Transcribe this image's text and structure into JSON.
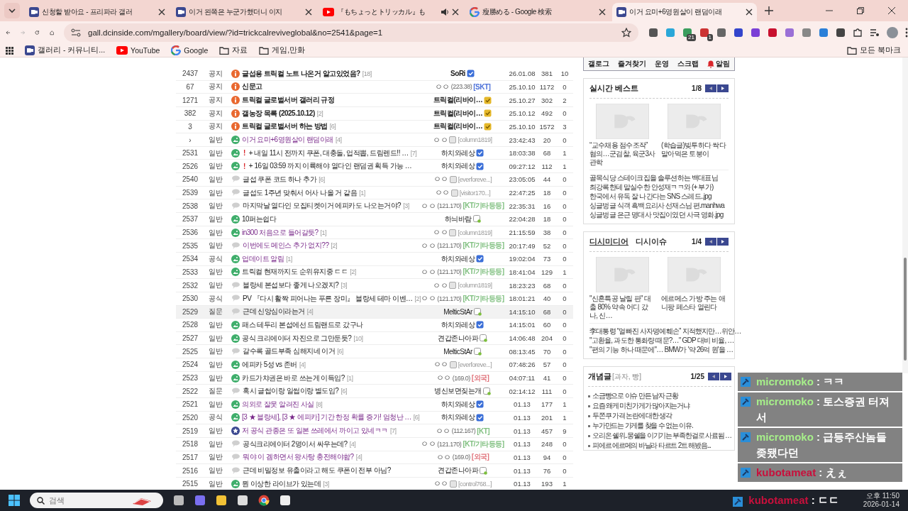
{
  "browser": {
    "tabs": [
      {
        "title": "신청할 받아요 - 프리파라 갤러",
        "kind": "dc",
        "audio": false,
        "selected": false
      },
      {
        "title": "이거 왼쪽은 누군가했더니 이지",
        "kind": "dc",
        "audio": false,
        "selected": false
      },
      {
        "title": "『もちょっとトリッカル』も",
        "kind": "youtube",
        "audio": true,
        "selected": false
      },
      {
        "title": "瘦勝める - Google 検索",
        "kind": "google",
        "audio": false,
        "selected": false
      },
      {
        "title": "이거 요미+6영원살이 랜덤이래",
        "kind": "dc",
        "audio": false,
        "selected": true
      }
    ],
    "url": "gall.dcinside.com/mgallery/board/view/?id=trickcalreviveglobal&no=2541&page=1",
    "extension_badges": [
      "21",
      "1"
    ],
    "bookmarks": [
      {
        "label": "갤러리 - 커뮤니티...",
        "kind": "dc"
      },
      {
        "label": "YouTube",
        "kind": "youtube"
      },
      {
        "label": "Google",
        "kind": "google"
      },
      {
        "label": "자료",
        "kind": "folder"
      },
      {
        "label": "게임,만화",
        "kind": "folder"
      }
    ],
    "all_bookmarks": "모든 북마크"
  },
  "posts": [
    {
      "num": "2437",
      "category": "공지",
      "kind": "notice",
      "title": "글섭용 트릭컬 노트 나온거 알고있었음?",
      "comments": "[18]",
      "visited": false,
      "hovered": false,
      "writer": {
        "kind": "nick",
        "name": "SoRi",
        "badge": {
          "kind": "fixed"
        }
      },
      "date": "26.01.08",
      "views": "381",
      "recommends": "10"
    },
    {
      "num": "67",
      "category": "공지",
      "kind": "notice",
      "title": "신문고",
      "visited": false,
      "hovered": false,
      "writer": {
        "kind": "anon",
        "name": "ㅇㅇ",
        "ip": "(223.38)",
        "carrier": "[SKT]",
        "color": "#4a6fd8"
      },
      "date": "25.10.10",
      "views": "1172",
      "recommends": "0"
    },
    {
      "num": "1271",
      "category": "공지",
      "kind": "notice",
      "title": "트릭컬 글로벌서버 갤러리 규정",
      "visited": false,
      "hovered": false,
      "writer": {
        "kind": "nick",
        "name": "트릭컬(리바이…",
        "badge": {
          "kind": "manager"
        }
      },
      "date": "25.10.27",
      "views": "302",
      "recommends": "2"
    },
    {
      "num": "382",
      "category": "공지",
      "kind": "notice",
      "title": "갤농장 목록 (2025.10.12)",
      "comments": "[2]",
      "visited": false,
      "hovered": false,
      "writer": {
        "kind": "nick",
        "name": "트릭컬(리바이…",
        "badge": {
          "kind": "manager"
        }
      },
      "date": "25.10.12",
      "views": "492",
      "recommends": "0"
    },
    {
      "num": "3",
      "category": "공지",
      "kind": "notice",
      "title": "트릭컬 글로벌서버 하는 방법",
      "comments": "[6]",
      "visited": false,
      "hovered": false,
      "writer": {
        "kind": "nick",
        "name": "트릭컬(리바이…",
        "badge": {
          "kind": "manager"
        }
      },
      "date": "25.10.10",
      "views": "1572",
      "recommends": "3"
    },
    {
      "num": "›",
      "category": "일반",
      "kind": "photo",
      "title": "이거 요미+6영원살이 랜덤이래",
      "comments": "[4]",
      "visited": true,
      "hovered": false,
      "writer": {
        "kind": "member",
        "name": "ㅇㅇ",
        "id": "[column1819]"
      },
      "date": "23:42:43",
      "views": "20",
      "recommends": "0"
    },
    {
      "num": "2531",
      "category": "일반",
      "kind": "photo",
      "flag": "!",
      "title": "+ 내일 11시 전까지 쿠폰, 대충돌, 업적뽑, 드림렌드!! …",
      "comments": "[7]",
      "visited": false,
      "hovered": false,
      "writer": {
        "kind": "nick",
        "name": "하치와레상",
        "badge": {
          "kind": "fixed"
        }
      },
      "date": "18:03:38",
      "views": "68",
      "recommends": "1"
    },
    {
      "num": "2526",
      "category": "일반",
      "kind": "photo",
      "flag": "!",
      "title": "+ 16일 03:59 까지 이륙해야 열다인 랜덤권 획득 가능 …",
      "visited": false,
      "hovered": false,
      "writer": {
        "kind": "nick",
        "name": "하치와레상",
        "badge": {
          "kind": "fixed"
        }
      },
      "date": "09:27:12",
      "views": "112",
      "recommends": "1"
    },
    {
      "num": "2540",
      "category": "일반",
      "kind": "text",
      "title": "글섭 쿠폰 코드 하나 추가",
      "comments": "[6]",
      "visited": false,
      "hovered": false,
      "writer": {
        "kind": "member",
        "name": "ㅇㅇ",
        "id": "[everforeve...]"
      },
      "date": "23:05:05",
      "views": "44",
      "recommends": "0"
    },
    {
      "num": "2539",
      "category": "일반",
      "kind": "text",
      "title": "글섭도 1주년 맞춰서 어사 나올 거 같음",
      "comments": "[1]",
      "visited": false,
      "hovered": false,
      "writer": {
        "kind": "member",
        "name": "ㅇㅇ",
        "id": "[visitor170...]"
      },
      "date": "22:47:25",
      "views": "18",
      "recommends": "0"
    },
    {
      "num": "2538",
      "category": "일반",
      "kind": "text",
      "title": "마지막날 열다인 모집티켓이거 에피카도 나오는거야?",
      "comments": "[3]",
      "visited": false,
      "hovered": false,
      "writer": {
        "kind": "anon",
        "name": "ㅇㅇ",
        "ip": "(121.170)",
        "carrier": "[KT/기타등등]",
        "color": "#7fbf7f"
      },
      "date": "22:35:31",
      "views": "16",
      "recommends": "0"
    },
    {
      "num": "2537",
      "category": "일반",
      "kind": "photo",
      "title": "10퍼는쉽다",
      "visited": false,
      "hovered": false,
      "writer": {
        "kind": "nick",
        "name": "하늬바람",
        "badge": {
          "kind": "half"
        }
      },
      "date": "22:04:28",
      "views": "18",
      "recommends": "0"
    },
    {
      "num": "2536",
      "category": "일반",
      "kind": "photo",
      "title": "in300 처음으로 들어갈듯?",
      "comments": "[1]",
      "visited": true,
      "hovered": false,
      "writer": {
        "kind": "member",
        "name": "ㅇㅇ",
        "id": "[column1819]"
      },
      "date": "21:15:59",
      "views": "38",
      "recommends": "0"
    },
    {
      "num": "2535",
      "category": "일반",
      "kind": "text",
      "title": "이번에도 메인스 추가 없지??",
      "comments": "[2]",
      "visited": true,
      "hovered": false,
      "writer": {
        "kind": "anon",
        "name": "ㅇㅇ",
        "ip": "(121.170)",
        "carrier": "[KT/기타등등]",
        "color": "#7fbf7f"
      },
      "date": "20:17:49",
      "views": "52",
      "recommends": "0"
    },
    {
      "num": "2534",
      "category": "공식",
      "kind": "photo",
      "title": "업데이트 알림",
      "comments": "[1]",
      "visited": true,
      "hovered": false,
      "writer": {
        "kind": "nick",
        "name": "하치와레상",
        "badge": {
          "kind": "fixed"
        }
      },
      "date": "19:02:04",
      "views": "73",
      "recommends": "0"
    },
    {
      "num": "2533",
      "category": "일반",
      "kind": "photo",
      "title": "트릭컬 현재까지도 순위유지중 ㄷㄷ",
      "comments": "[2]",
      "visited": false,
      "hovered": false,
      "writer": {
        "kind": "anon",
        "name": "ㅇㅇ",
        "ip": "(121.170)",
        "carrier": "[KT/기타등등]",
        "color": "#7fbf7f"
      },
      "date": "18:41:04",
      "views": "129",
      "recommends": "1"
    },
    {
      "num": "2532",
      "category": "일반",
      "kind": "text",
      "title": "블랑세 본섭보다 좋게 나오겠지?",
      "comments": "[3]",
      "visited": false,
      "hovered": false,
      "writer": {
        "kind": "member",
        "name": "ㅇㅇ",
        "id": "[column1819]"
      },
      "date": "18:23:23",
      "views": "68",
      "recommends": "0"
    },
    {
      "num": "2530",
      "category": "공식",
      "kind": "text",
      "title": "PV 『다시 활짝 피어나는 푸른 장미』 블랑세 테마 이벤…",
      "comments": "[2]",
      "visited": false,
      "hovered": false,
      "writer": {
        "kind": "anon",
        "name": "ㅇㅇ",
        "ip": "(121.170)",
        "carrier": "[KT/기타등등]",
        "color": "#7fbf7f"
      },
      "date": "18:01:21",
      "views": "40",
      "recommends": "0"
    },
    {
      "num": "2529",
      "category": "질문",
      "kind": "text",
      "title": "근데 신앙심이라는거",
      "comments": "[4]",
      "visited": false,
      "hovered": true,
      "writer": {
        "kind": "nick",
        "name": "MelticStAr",
        "badge": {
          "kind": "half"
        }
      },
      "date": "14:15:10",
      "views": "68",
      "recommends": "0"
    },
    {
      "num": "2528",
      "category": "일반",
      "kind": "photo",
      "title": "패스 테두리 본섭에선 드림랜드로 갔구나",
      "visited": false,
      "hovered": false,
      "writer": {
        "kind": "nick",
        "name": "하치와레상",
        "badge": {
          "kind": "fixed"
        }
      },
      "date": "14:15:01",
      "views": "60",
      "recommends": "0"
    },
    {
      "num": "2527",
      "category": "일반",
      "kind": "photo",
      "title": "공식 크리에이터 자진으로 그만둔듯?",
      "comments": "[10]",
      "visited": false,
      "hovered": false,
      "writer": {
        "kind": "nick",
        "name": "견갑존나아파",
        "badge": {
          "kind": "half"
        }
      },
      "date": "14:06:48",
      "views": "204",
      "recommends": "0"
    },
    {
      "num": "2525",
      "category": "일반",
      "kind": "text",
      "title": "갈수록 골드부족 심해지네 이거",
      "comments": "[6]",
      "visited": false,
      "hovered": false,
      "writer": {
        "kind": "nick",
        "name": "MelticStAr",
        "badge": {
          "kind": "half"
        }
      },
      "date": "08:13:45",
      "views": "70",
      "recommends": "0"
    },
    {
      "num": "2524",
      "category": "일반",
      "kind": "photo",
      "title": "에피카 5성 vs 존버",
      "comments": "[4]",
      "visited": false,
      "hovered": false,
      "writer": {
        "kind": "member",
        "name": "ㅇㅇ",
        "id": "[everforeve...]"
      },
      "date": "07:48:26",
      "views": "57",
      "recommends": "0"
    },
    {
      "num": "2523",
      "category": "일반",
      "kind": "photo",
      "title": "카드가챠권은 바로 쓰는게 이득임?",
      "comments": "[1]",
      "visited": false,
      "hovered": false,
      "writer": {
        "kind": "anon",
        "name": "ㅇㅇ",
        "ip": "(169.0)",
        "carrier": "[외국]",
        "color": "#e0737b"
      },
      "date": "04:07:11",
      "views": "41",
      "recommends": "0"
    },
    {
      "num": "2522",
      "category": "질문",
      "kind": "text",
      "title": "혹시 글썹이랑 일썹이랑 별도임?",
      "comments": "[6]",
      "visited": false,
      "hovered": false,
      "writer": {
        "kind": "nick",
        "name": "병신보면짖는개",
        "badge": {
          "kind": "half"
        }
      },
      "date": "02:14:12",
      "views": "111",
      "recommends": "0"
    },
    {
      "num": "2521",
      "category": "일반",
      "kind": "photo",
      "title": "의외로 잘못 알려진 사실",
      "comments": "[8]",
      "visited": true,
      "hovered": false,
      "writer": {
        "kind": "nick",
        "name": "하치와레상",
        "badge": {
          "kind": "fixed"
        }
      },
      "date": "01.13",
      "views": "177",
      "recommends": "1"
    },
    {
      "num": "2520",
      "category": "공식",
      "kind": "photo",
      "title": "[3 ★ 블랑세], [3 ★ 에피카] 기간 한정 확률 증가! 엄청난 …",
      "comments": "[6]",
      "visited": true,
      "hovered": false,
      "writer": {
        "kind": "nick",
        "name": "하치와레상",
        "badge": {
          "kind": "fixed"
        }
      },
      "date": "01.13",
      "views": "201",
      "recommends": "1"
    },
    {
      "num": "2519",
      "category": "일반",
      "kind": "recommended",
      "title": "저 공식 관종은 또 일본 쓰레에서 까이고 있네ㅋㅋ",
      "comments": "[7]",
      "visited": true,
      "hovered": false,
      "writer": {
        "kind": "anon",
        "name": "ㅇㅇ",
        "ip": "(112.167)",
        "carrier": "[KT]",
        "color": "#7fbf7f"
      },
      "date": "01.13",
      "views": "457",
      "recommends": "9"
    },
    {
      "num": "2518",
      "category": "일반",
      "kind": "text",
      "title": "공식크리에이터 2명이서 싸우는데?",
      "comments": "[4]",
      "visited": false,
      "hovered": false,
      "writer": {
        "kind": "anon",
        "name": "ㅇㅇ",
        "ip": "(121.170)",
        "carrier": "[KT/기타등등]",
        "color": "#7fbf7f"
      },
      "date": "01.13",
      "views": "248",
      "recommends": "0"
    },
    {
      "num": "2517",
      "category": "일반",
      "kind": "text",
      "title": "뭐야 이 겜하면서 왕사탕 충전해야함?",
      "comments": "[4]",
      "visited": true,
      "hovered": false,
      "writer": {
        "kind": "anon",
        "name": "ㅇㅇ",
        "ip": "(169.0)",
        "carrier": "[외국]",
        "color": "#e0737b"
      },
      "date": "01.13",
      "views": "94",
      "recommends": "0"
    },
    {
      "num": "2516",
      "category": "일반",
      "kind": "text",
      "title": "근데 비밀정보 유출이라고 해도 쿠폰이 전부 아님?",
      "visited": false,
      "hovered": false,
      "writer": {
        "kind": "nick",
        "name": "견갑존나아파",
        "badge": {
          "kind": "half"
        }
      },
      "date": "01.13",
      "views": "76",
      "recommends": "0"
    },
    {
      "num": "2515",
      "category": "일반",
      "kind": "photo",
      "title": "뭔 이상한 라이브가 있는데",
      "comments": "[3]",
      "visited": false,
      "hovered": false,
      "writer": {
        "kind": "member",
        "name": "ㅇㅇ",
        "id": "[control768...]"
      },
      "date": "01.13",
      "views": "193",
      "recommends": "1"
    }
  ],
  "sidebar": {
    "nav": [
      "갤로그",
      "즐겨찾기",
      "운영",
      "스크랩",
      "알림"
    ],
    "best": {
      "title": "실시간 베스트",
      "page": "1/8",
      "thumbs": [
        "“교수채용 점수조작” 혐의…군검찰, 육군3사관학",
        "(학습글)빚투하다 싹다 말아먹은 토붕이"
      ],
      "links": [
        "골목식당 스테이크집을 솔루션하는 백대표님",
        "최강록한테 말실수한 안성재ㅋㅋ와 (+ 부가)",
        "한국에서 유독 잘 나간다는 SNS 스레드..jpg",
        "싱글벙글 식객 흑백요리사 선재스님 편.manhwa",
        "싱글벙글 은근 명대사 맛집이였던 사극 영화.jpg"
      ]
    },
    "media": {
      "tabs": [
        {
          "label": "디시미디어",
          "selected": true
        },
        {
          "label": "디시이슈",
          "selected": false
        }
      ],
      "page": "1/4",
      "thumbs": [
        "\"신혼특공 날릴 판\" 대출 80% 약속 어디 갔나, 신…",
        "에르메스 가방 주는 애니팡 페스타 열린다"
      ],
      "links": [
        "李대통령 “얼빠진 사자명예훼손” 지적했지만…위안…",
        "\"고환율, 과도한 통화량 때문?…\" GDP 대비 비율, …",
        "\"편의 기능 하나 때문에\"… BMW가 '약 26억 원'을 …"
      ]
    },
    "concept": {
      "title": "개념글",
      "subtitle": "[과자, 빵]",
      "page": "1/25",
      "links": [
        "소금빵으로 이슈 만든 남자 근황",
        "요즘 왜케 미친가게가 많아지는거냐",
        "두쫀쿠 가격 논란에 대한 생각",
        "누가만드는 가게를 찾을 수 없는 이유.",
        "오리온 쉘위..몽쉘을 이기기는 부족한걸로 사료됨 …",
        "피에르 에르메의 바닐라 타르트 2트 해봤음..."
      ]
    }
  },
  "chat": [
    {
      "user": "micromoko",
      "color": "#a6ee8a",
      "text": ": ㅋㅋ"
    },
    {
      "user": "micromoko",
      "color": "#a6ee8a",
      "text": ": 토스증권 터져서"
    },
    {
      "user": "micromoko",
      "color": "#a6ee8a",
      "text": ": 급등주산놈들 좆됐다던"
    },
    {
      "user": "kubotameat",
      "color": "#c8103c",
      "text": ": えぇ"
    }
  ],
  "taskbar": {
    "search_placeholder": "검색",
    "chat_latest": {
      "user": "kubotameat",
      "color": "#c8103c",
      "text": ": ㄷㄷ"
    },
    "time": "오후 11:50",
    "date": "2026-01-14"
  }
}
